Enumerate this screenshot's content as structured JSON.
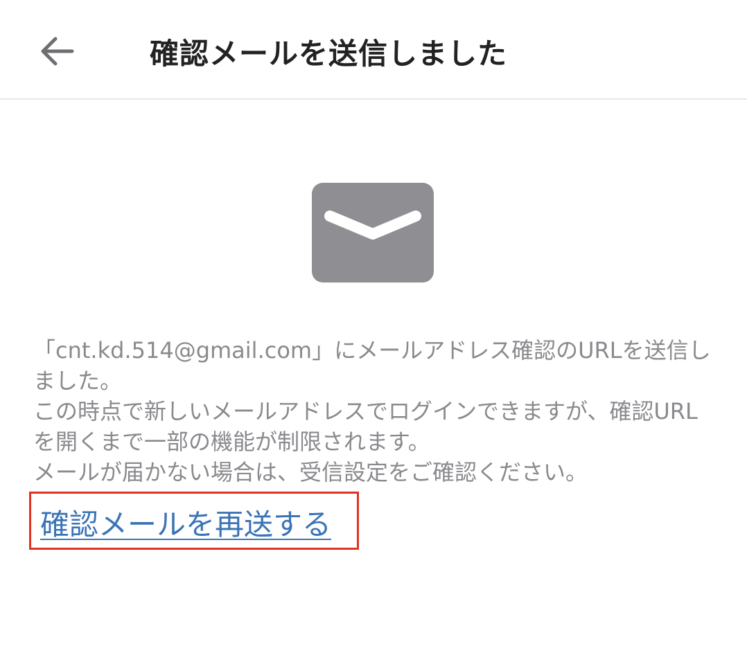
{
  "header": {
    "back_icon": "arrow-left-icon",
    "title": "確認メールを送信しました"
  },
  "main": {
    "icon": "envelope-icon",
    "message_lines": [
      "「cnt.kd.514@gmail.com」にメールアドレス確認のURLを送信しました。",
      "この時点で新しいメールアドレスでログインできますが、確認URLを開くまで一部の機能が制限されます。",
      "メールが届かない場合は、受信設定をご確認ください。"
    ],
    "resend_link": "確認メールを再送する"
  },
  "colors": {
    "icon_gray": "#8e8e93",
    "text_gray": "#8a8a8e",
    "link_blue": "#3a74b6",
    "highlight_red": "#e2321f"
  }
}
